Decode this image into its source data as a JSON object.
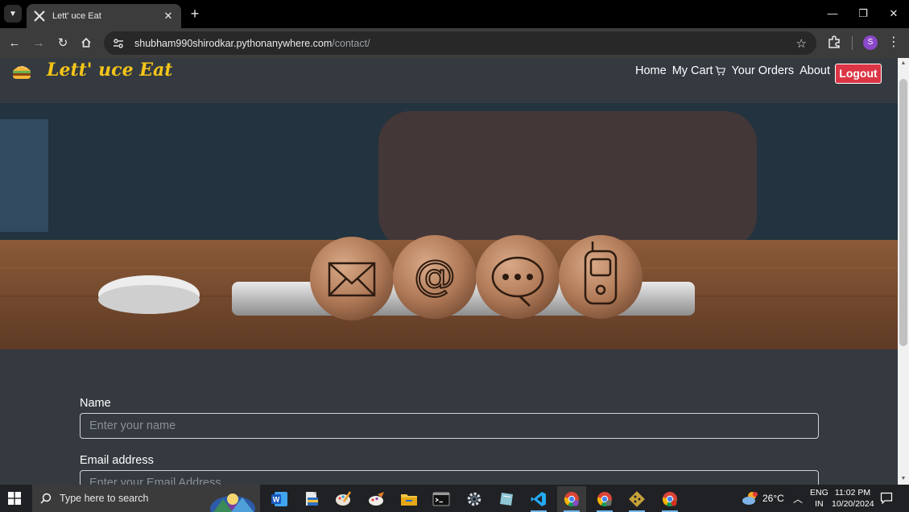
{
  "browser": {
    "tab_title": "Lett' uce Eat",
    "url_domain": "shubham990shirodkar.pythonanywhere.com",
    "url_path": "/contact/",
    "profile_initial": "S"
  },
  "site": {
    "brand": "Lett' uce Eat",
    "nav": [
      "Home",
      "My Cart",
      "Your Orders",
      "About"
    ],
    "logout_label": "Logout",
    "colors": {
      "brand": "#f5c518",
      "logout": "#dc3545",
      "background": "#343a40"
    }
  },
  "form": {
    "name_label": "Name",
    "name_placeholder": "Enter your name",
    "email_label": "Email address",
    "email_placeholder": "Enter your Email Address"
  },
  "taskbar": {
    "search_placeholder": "Type here to search",
    "apps": [
      "word-icon",
      "file-manager-icon",
      "paint-icon",
      "paint-brush-icon",
      "file-explorer-icon",
      "terminal-icon",
      "settings-icon",
      "notes-icon",
      "vscode-icon",
      "chrome-icon",
      "chrome-icon",
      "git-icon",
      "chrome-icon"
    ],
    "temperature": "26°C",
    "lang_line1": "ENG",
    "lang_line2": "IN",
    "time": "11:02 PM",
    "date": "10/20/2024"
  }
}
